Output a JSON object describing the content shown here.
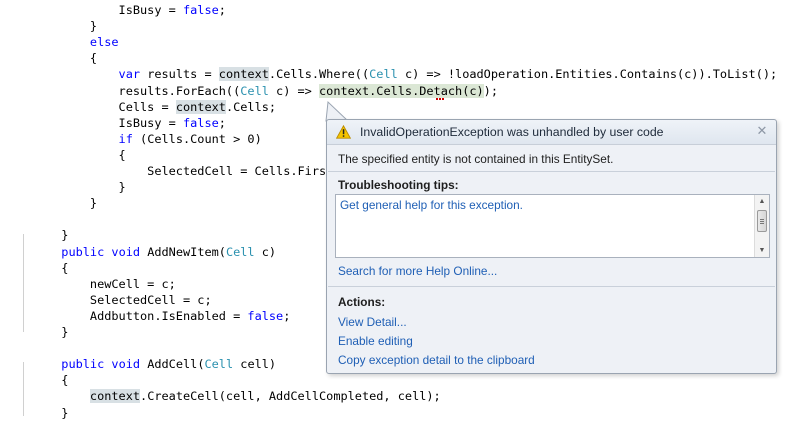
{
  "editor": {
    "lines": [
      [
        {
          "t": "                "
        },
        {
          "t": "IsBusy = "
        },
        {
          "t": "false",
          "c": "kw"
        },
        {
          "t": ";"
        }
      ],
      [
        {
          "t": "            }"
        }
      ],
      [
        {
          "t": "            "
        },
        {
          "t": "else",
          "c": "kw"
        }
      ],
      [
        {
          "t": "            {"
        }
      ],
      [
        {
          "t": "                "
        },
        {
          "t": "var",
          "c": "kw"
        },
        {
          "t": " results = "
        },
        {
          "t": "context",
          "c": "hl"
        },
        {
          "t": ".Cells.Where(("
        },
        {
          "t": "Cell",
          "c": "ty"
        },
        {
          "t": " c) => !loadOperation.Entities.Contains(c)).ToList();"
        }
      ],
      [
        {
          "t": "                "
        },
        {
          "t": "results.ForEach(("
        },
        {
          "t": "Cell",
          "c": "ty"
        },
        {
          "t": " c) => "
        },
        {
          "t": "context.Cells.Detach(c)",
          "c": "hl-stmt"
        },
        {
          "t": ");"
        }
      ],
      [
        {
          "t": "                "
        },
        {
          "t": "Cells = "
        },
        {
          "t": "context",
          "c": "hl"
        },
        {
          "t": ".Cells;"
        }
      ],
      [
        {
          "t": "                "
        },
        {
          "t": "IsBusy = "
        },
        {
          "t": "false",
          "c": "kw"
        },
        {
          "t": ";"
        }
      ],
      [
        {
          "t": "                "
        },
        {
          "t": "if",
          "c": "kw"
        },
        {
          "t": " (Cells.Count > 0)"
        }
      ],
      [
        {
          "t": "                {"
        }
      ],
      [
        {
          "t": "                    SelectedCell = Cells.First();"
        }
      ],
      [
        {
          "t": "                }"
        }
      ],
      [
        {
          "t": "            }"
        }
      ],
      [
        {
          "t": ""
        }
      ],
      [
        {
          "t": "        }"
        }
      ],
      [
        {
          "t": "        "
        },
        {
          "t": "public",
          "c": "kw"
        },
        {
          "t": " "
        },
        {
          "t": "void",
          "c": "kw"
        },
        {
          "t": " AddNewItem("
        },
        {
          "t": "Cell",
          "c": "ty"
        },
        {
          "t": " c)"
        }
      ],
      [
        {
          "t": "        {"
        }
      ],
      [
        {
          "t": "            newCell = c;"
        }
      ],
      [
        {
          "t": "            SelectedCell = c;"
        }
      ],
      [
        {
          "t": "            Addbutton.IsEnabled = "
        },
        {
          "t": "false",
          "c": "kw"
        },
        {
          "t": ";"
        }
      ],
      [
        {
          "t": "        }"
        }
      ],
      [
        {
          "t": ""
        }
      ],
      [
        {
          "t": "        "
        },
        {
          "t": "public",
          "c": "kw"
        },
        {
          "t": " "
        },
        {
          "t": "void",
          "c": "kw"
        },
        {
          "t": " AddCell("
        },
        {
          "t": "Cell",
          "c": "ty"
        },
        {
          "t": " cell)"
        }
      ],
      [
        {
          "t": "        {"
        }
      ],
      [
        {
          "t": "            "
        },
        {
          "t": "context",
          "c": "hl"
        },
        {
          "t": ".CreateCell(cell, AddCellCompleted, cell);"
        }
      ],
      [
        {
          "t": "        }"
        }
      ]
    ]
  },
  "exception": {
    "title": "InvalidOperationException was unhandled by user code",
    "close_glyph": "✕",
    "message": "The specified entity is not contained in this EntitySet.",
    "tips_heading": "Troubleshooting tips:",
    "tips": [
      "Get general help for this exception."
    ],
    "search_link": "Search for more Help Online...",
    "actions_heading": "Actions:",
    "actions": [
      "View Detail...",
      "Enable editing",
      "Copy exception detail to the clipboard"
    ]
  },
  "icons": {
    "warning": "warning-triangle-icon",
    "close": "close-icon"
  },
  "colors": {
    "keyword": "#0000ff",
    "type": "#2b91af",
    "link": "#1f5fb5",
    "popup_background": "#eef1f6",
    "highlight": "#d8e0e4"
  }
}
